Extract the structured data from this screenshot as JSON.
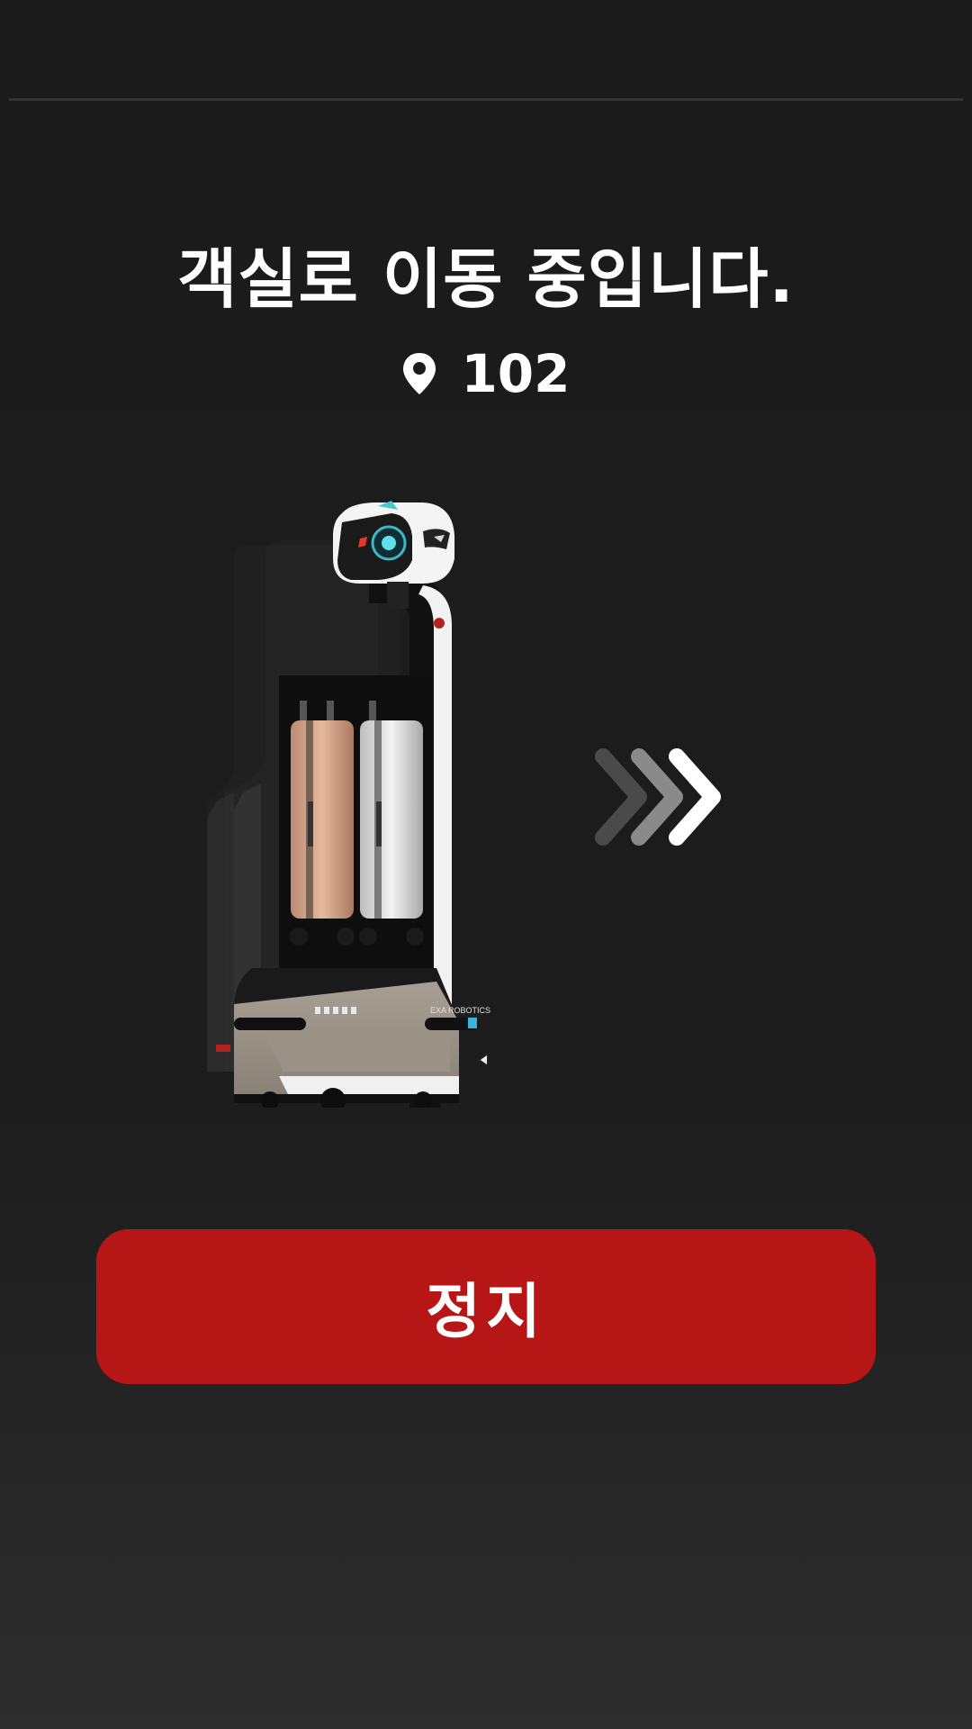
{
  "status": {
    "headline": "객실로 이동 중입니다.",
    "destination_icon": "location-pin-icon",
    "room_number": "102"
  },
  "robot_image": {
    "brand_text": "EXA ROBOTICS"
  },
  "direction_icon": "triple-chevron-right-icon",
  "actions": {
    "stop_label": "정지"
  },
  "colors": {
    "background": "#1b1b1b",
    "stop_button": "#b71616",
    "text": "#ffffff"
  }
}
